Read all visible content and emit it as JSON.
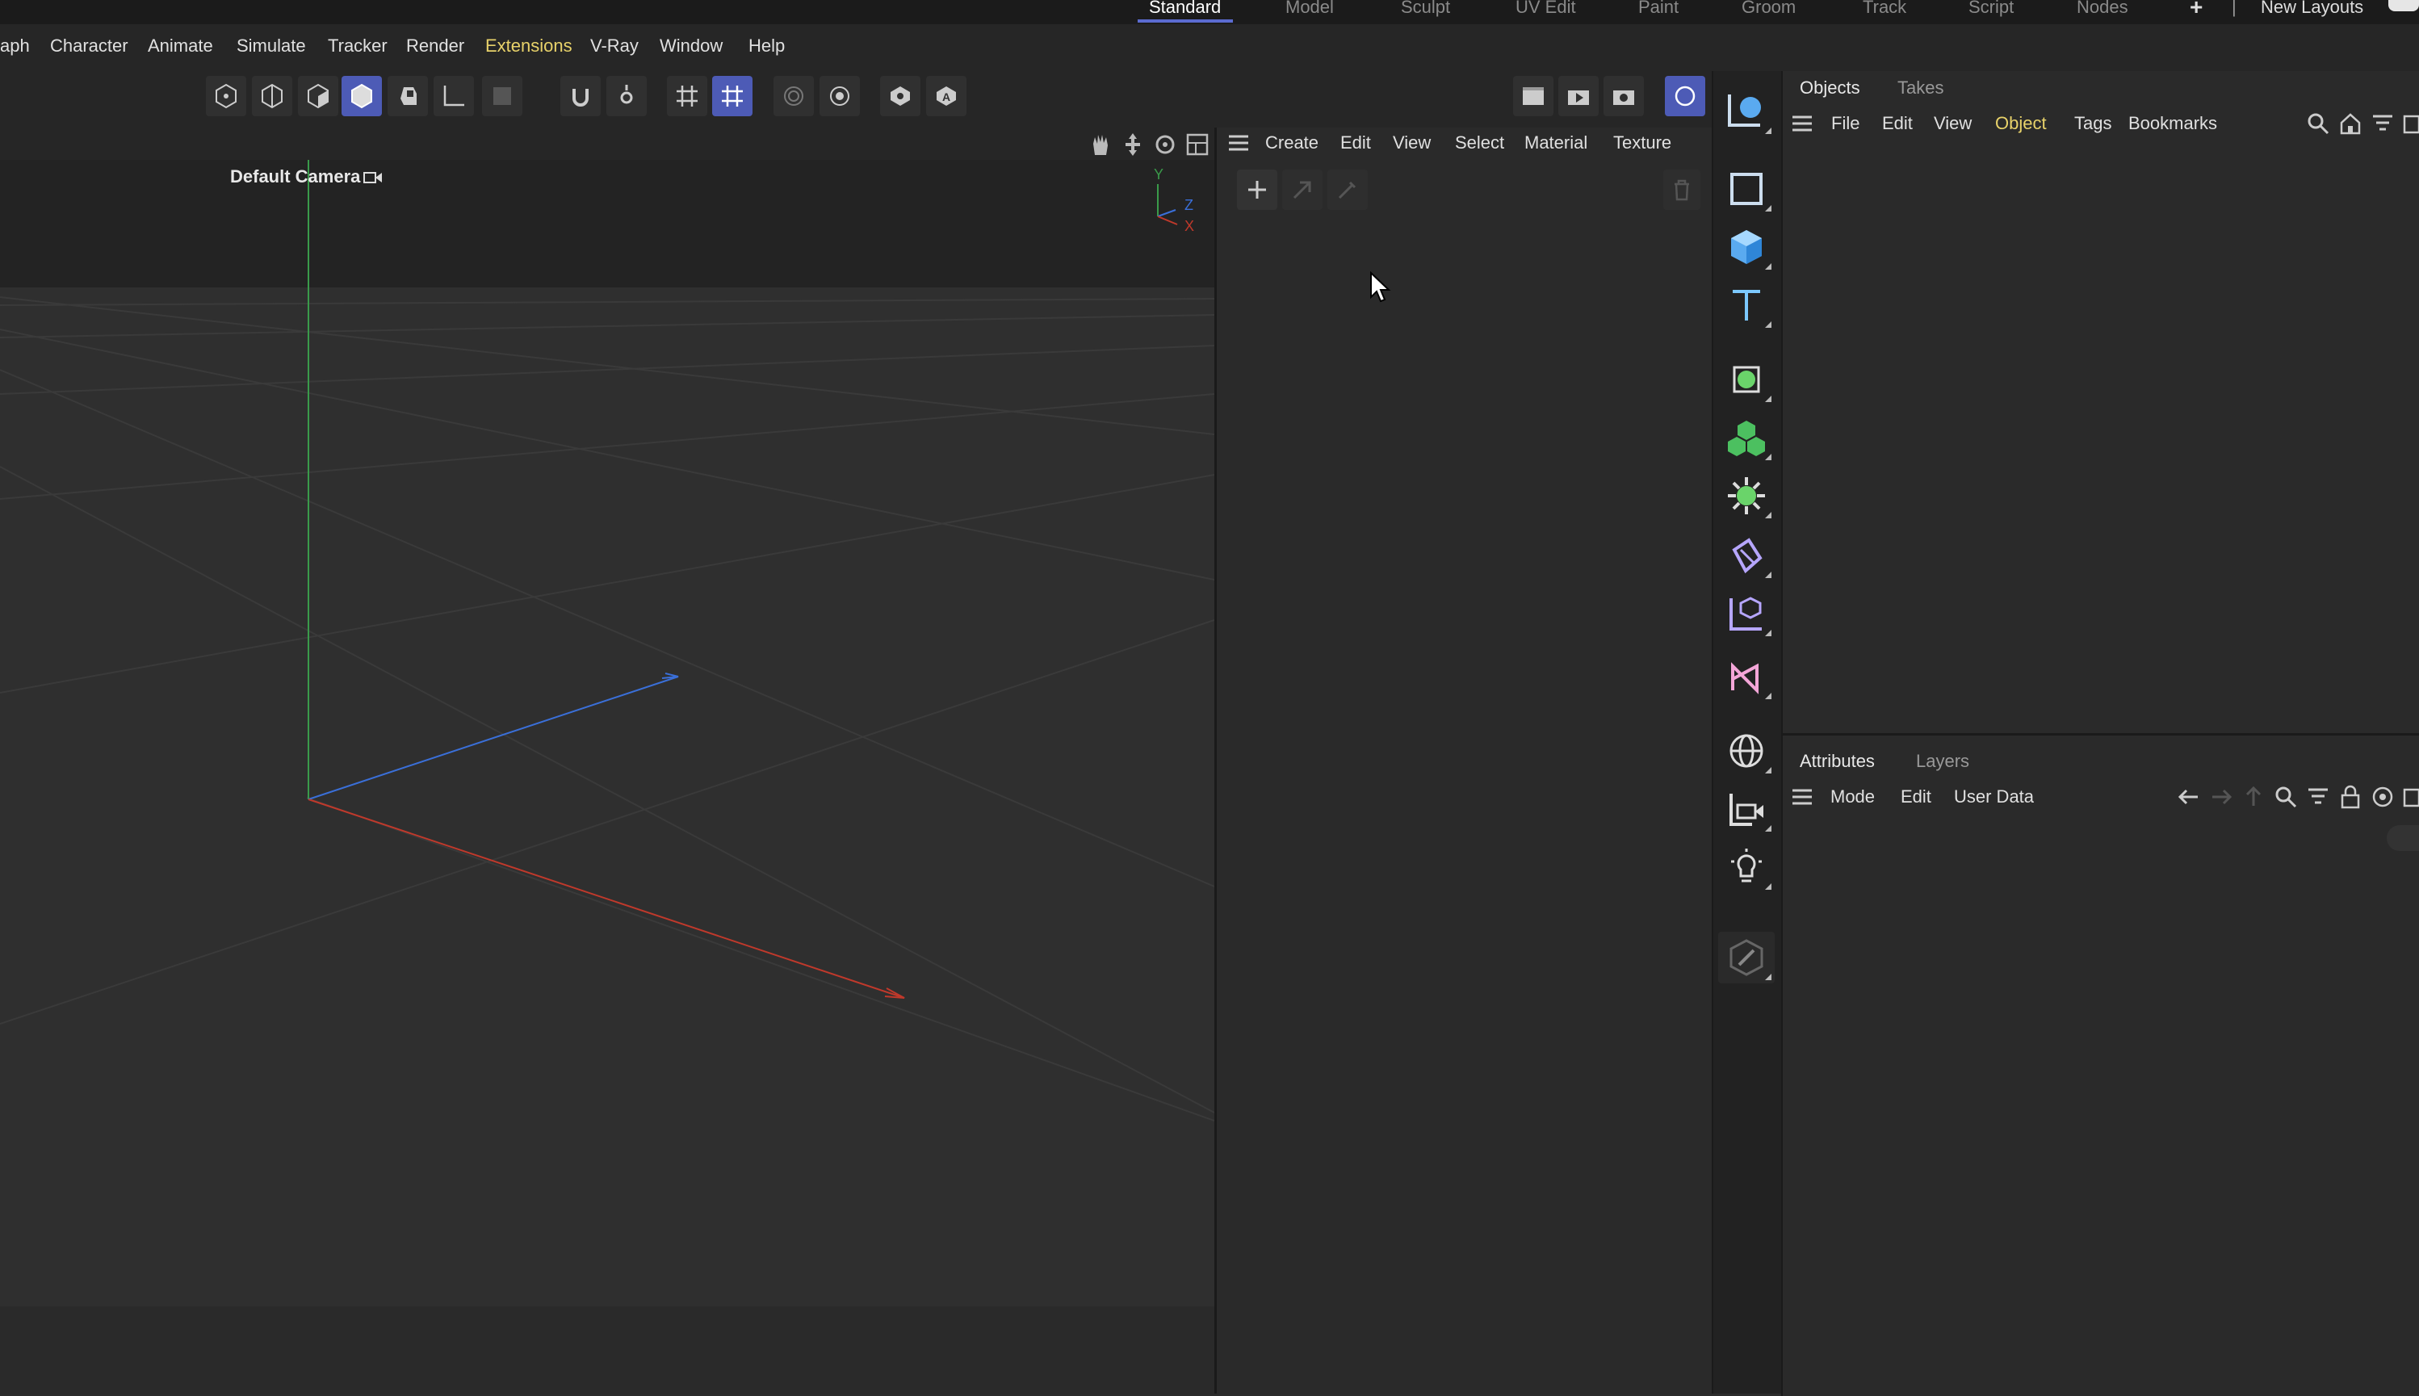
{
  "layout_tabs": [
    "Standard",
    "Model",
    "Sculpt",
    "UV Edit",
    "Paint",
    "Groom",
    "Track",
    "Script",
    "Nodes"
  ],
  "layout_add": "+",
  "layout_separator": "|",
  "new_layouts": "New Layouts",
  "menu": [
    "aph",
    "Character",
    "Animate",
    "Simulate",
    "Tracker",
    "Render",
    "Extensions",
    "V-Ray",
    "Window",
    "Help"
  ],
  "viewport": {
    "camera_label": "Default Camera",
    "axis": {
      "y": "Y",
      "z": "Z",
      "x": "X"
    }
  },
  "material_manager": {
    "menu": [
      "Create",
      "Edit",
      "View",
      "Select",
      "Material",
      "Texture"
    ]
  },
  "objects_panel": {
    "tabs": [
      "Objects",
      "Takes"
    ],
    "menu": [
      "File",
      "Edit",
      "View",
      "Object",
      "Tags",
      "Bookmarks"
    ]
  },
  "attributes_panel": {
    "tabs": [
      "Attributes",
      "Layers"
    ],
    "menu": [
      "Mode",
      "Edit",
      "User Data"
    ]
  },
  "colors": {
    "accent": "#5b6bd0",
    "highlight_menu": "#e8d26a",
    "selected_tool": "#4d5bb6",
    "axis_x": "#c0392b",
    "axis_y": "#2ecc71",
    "axis_z": "#3a6fd8"
  }
}
